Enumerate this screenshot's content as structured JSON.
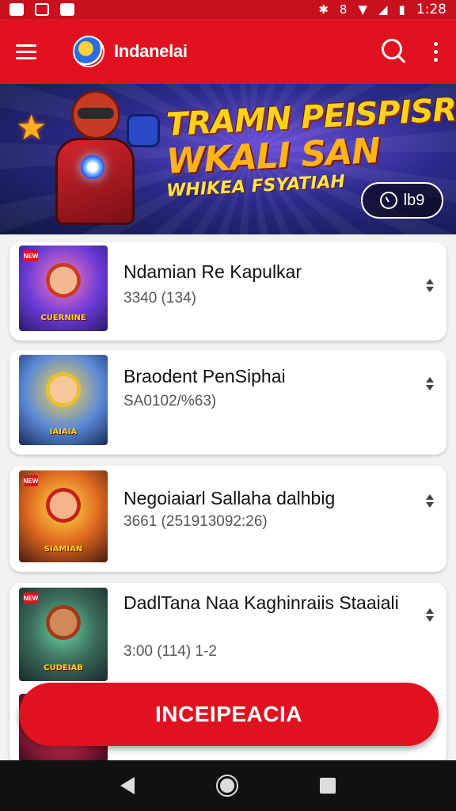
{
  "status_bar": {
    "left_icons": [
      "notification-icon",
      "image-icon",
      "gallery-icon"
    ],
    "right_icons": [
      "bluetooth-icon",
      "vibrate-icon",
      "wifi-icon",
      "signal-icon",
      "battery-icon"
    ],
    "time": "1:28"
  },
  "app_bar": {
    "title": "Indanelai",
    "menu_icon": "hamburger-menu-icon",
    "search_icon": "search-icon",
    "more_icon": "more-vertical-icon",
    "color": "#e0121f"
  },
  "banner": {
    "line1": "TRAMN PEISPISR!",
    "line2": "WKALI SAN",
    "line3": "WHIKEA FSYATIAH",
    "timer": "lb9"
  },
  "games": [
    {
      "title": "Ndamian Re Kapulkar",
      "subtitle": "3340 (134)",
      "thumb_caption": "CUERNINE"
    },
    {
      "title": "Braodent PenSiphai",
      "subtitle": "SA0102/%63)",
      "thumb_caption": "IAIAIA"
    },
    {
      "title": "Negoiaiarl Sallaha dalhbig",
      "subtitle": "3661 (251913092:26)",
      "thumb_caption": "SIAMIAN"
    },
    {
      "title": "DadlTana Naa Kaghinraiis Staaiali",
      "subtitle": "3:00 (114) 1-2",
      "thumb_caption": "CUDEIAB"
    }
  ],
  "cta": {
    "label": "INCEIPEACIA"
  },
  "nav_bar": {
    "back_icon": "back-icon",
    "home_icon": "home-icon",
    "recents_icon": "recents-icon"
  }
}
